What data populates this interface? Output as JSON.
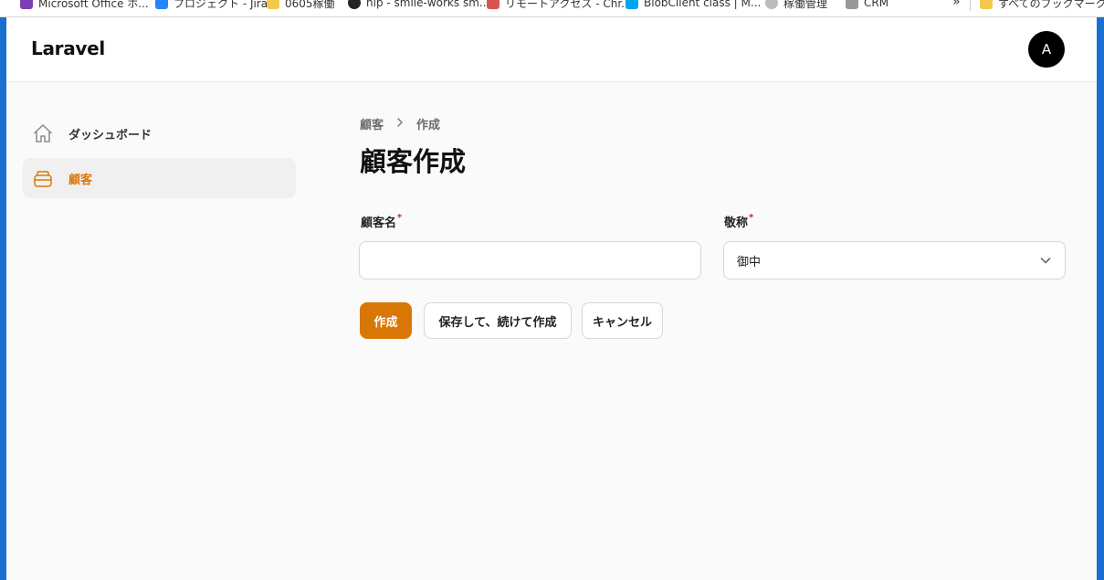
{
  "bookmarks": [
    {
      "label": "Microsoft Office ホ...",
      "icon": "office-icon",
      "color": "#7b3fb5"
    },
    {
      "label": "プロジェクト - Jira",
      "icon": "jira-icon",
      "color": "#2684ff"
    },
    {
      "label": "0605稼働",
      "icon": "folder-icon",
      "color": "#f2c94c"
    },
    {
      "label": "nip - smile-works sm...",
      "icon": "github-icon",
      "color": "#222222"
    },
    {
      "label": "リモートアクセス - Chr...",
      "icon": "chrome-remote-icon",
      "color": "#d9534f"
    },
    {
      "label": "BlobClient class | M...",
      "icon": "microsoft-icon",
      "color": "#00a4ef"
    },
    {
      "label": "稼働管理",
      "icon": "clock-icon",
      "color": "#888888"
    },
    {
      "label": "CRM",
      "icon": "page-icon",
      "color": "#666666"
    }
  ],
  "bookmarks_more": "»",
  "bookmarks_all": "すべてのブックマーク",
  "app": {
    "brand": "Laravel",
    "avatar_initial": "A",
    "accent_color": "#d97706"
  },
  "sidebar": {
    "items": [
      {
        "label": "ダッシュボード",
        "icon": "home-icon",
        "active": false
      },
      {
        "label": "顧客",
        "icon": "inbox-stack-icon",
        "active": true
      }
    ]
  },
  "breadcrumb": {
    "parent": "顧客",
    "separator_icon": "chevron-right-icon",
    "current": "作成"
  },
  "page_title": "顧客作成",
  "form": {
    "customer_name": {
      "label": "顧客名",
      "required_mark": "*",
      "value": ""
    },
    "honorific": {
      "label": "敬称",
      "required_mark": "*",
      "selected": "御中"
    }
  },
  "actions": {
    "create": "作成",
    "save_and_continue": "保存して、続けて作成",
    "cancel": "キャンセル"
  }
}
